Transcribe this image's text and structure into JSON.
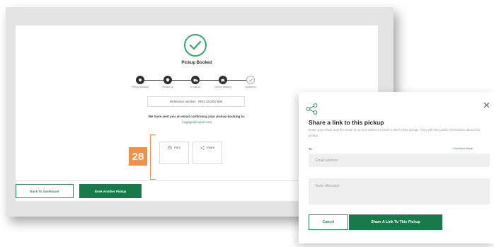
{
  "booking": {
    "title": "Pickup Booked",
    "steps": [
      {
        "label": "Pickup booked"
      },
      {
        "label": "Picked up"
      },
      {
        "label": "In transit"
      },
      {
        "label": "Out for delivery"
      },
      {
        "label": "Delivered"
      }
    ],
    "reference": "Reference number : PRO 421000 689",
    "email_notice": "We have sent you an email confirming your pickup booking to:",
    "email_address": "mygaga@mytort.com",
    "badge": "28",
    "card_print": "Print",
    "card_share": "Share",
    "back_button": "Back To Dashboard",
    "book_button": "Book Another Pickup"
  },
  "modal": {
    "title": "Share a link to this pickup",
    "description": "Enter your email and the email of up to 5 others to share a link to this pickup. They will see public information about this pickup.",
    "to_label": "To",
    "add_more": "+ Add More Email",
    "email_placeholder": "Email address",
    "message_placeholder": "Enter Message",
    "cancel_button": "Cancel",
    "share_button": "Share A Link To This Pickup"
  },
  "colors": {
    "accent_green": "#167a4a",
    "success_green": "#3aa66a",
    "badge_orange": "#f0914a"
  },
  "icons": {
    "success": "check-circle-icon",
    "share": "share-icon",
    "print": "print-icon",
    "close": "close-icon"
  }
}
